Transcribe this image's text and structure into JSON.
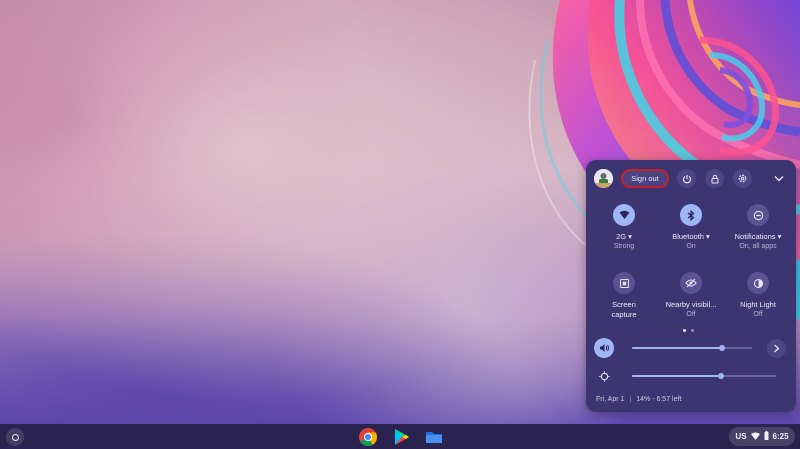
{
  "quick_settings": {
    "sign_out_label": "Sign out",
    "tiles": [
      {
        "label": "2G",
        "sub": "Strong",
        "icon": "wifi-icon",
        "has_dropdown": true,
        "state": "on"
      },
      {
        "label": "Bluetooth",
        "sub": "On",
        "icon": "bluetooth-icon",
        "has_dropdown": true,
        "state": "on"
      },
      {
        "label": "Notifications",
        "sub": "On, all apps",
        "icon": "do-not-disturb-icon",
        "has_dropdown": true,
        "state": "off"
      },
      {
        "label": "Screen",
        "label2": "capture",
        "sub": "",
        "icon": "screen-capture-icon",
        "state": "off"
      },
      {
        "label": "Nearby visibil...",
        "sub": "Off",
        "icon": "nearby-visibility-icon",
        "state": "off"
      },
      {
        "label": "Night Light",
        "sub": "Off",
        "icon": "night-light-icon",
        "state": "off"
      }
    ],
    "page_dots": {
      "count": 2,
      "active": 0
    },
    "volume_level": 0.75,
    "brightness_level": 0.62,
    "footer": {
      "date": "Fri, Apr 1",
      "battery": "14% - 6:57 left"
    }
  },
  "shelf": {
    "apps": [
      "chrome-icon",
      "play-store-icon",
      "files-icon"
    ],
    "status": {
      "ime": "US",
      "time": "6:25"
    }
  },
  "colors": {
    "accent": "#9fb6f5",
    "panel": "#3d3572",
    "highlight": "#c8202a"
  }
}
